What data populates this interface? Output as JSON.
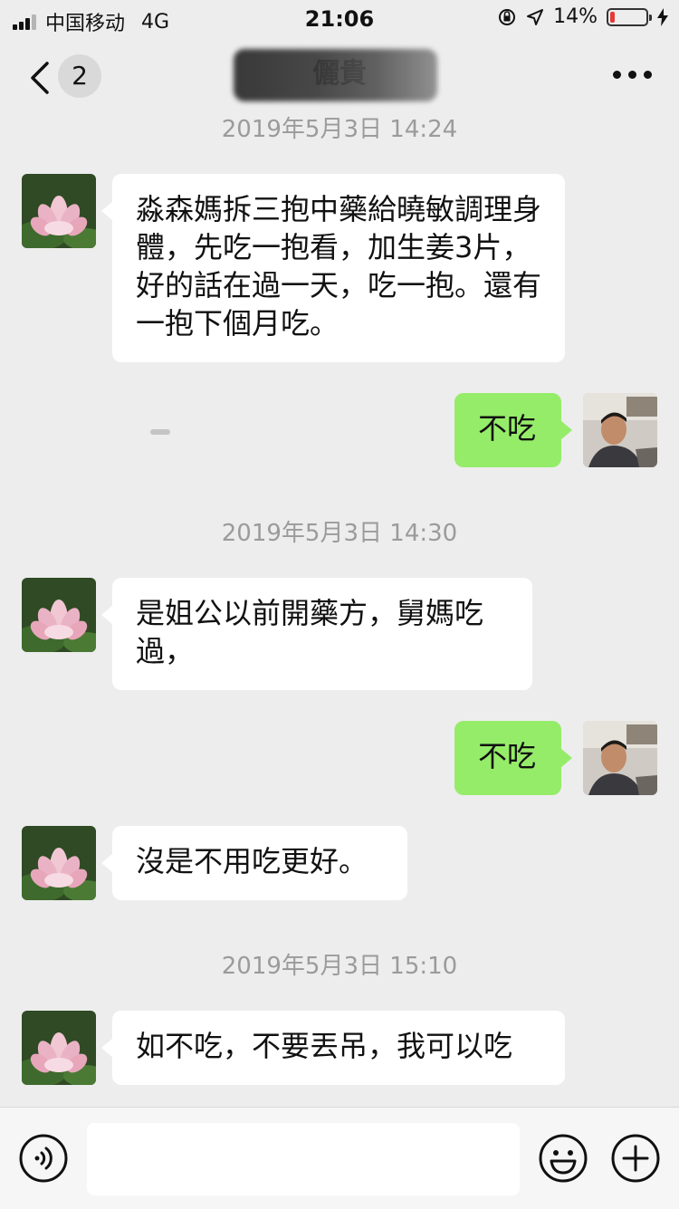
{
  "status_bar": {
    "carrier": "中国移动",
    "network": "4G",
    "time": "21:06",
    "battery_percent": "14%",
    "battery_level": 0.14,
    "battery_color": "#e53935"
  },
  "nav": {
    "unread_count": "2",
    "title": "儷貴",
    "back_icon": "chevron-left-icon",
    "more_icon": "more-dots-icon"
  },
  "messages": [
    {
      "type": "time",
      "text": "2019年5月3日 14:24"
    },
    {
      "type": "in",
      "text": "淼森媽拆三抱中藥給曉敏調理身體，先吃一抱看，加生姜3片，好的話在過一天，吃一抱。還有一抱下個月吃。"
    },
    {
      "type": "out",
      "text": "不吃"
    },
    {
      "type": "time",
      "text": "2019年5月3日 14:30"
    },
    {
      "type": "in",
      "text": "是姐公以前開藥方，舅媽吃過，"
    },
    {
      "type": "out",
      "text": "不吃"
    },
    {
      "type": "in",
      "text": "沒是不用吃更好。"
    },
    {
      "type": "time",
      "text": "2019年5月3日 15:10"
    },
    {
      "type": "in",
      "text": "如不吃，不要丟吊，我可以吃"
    }
  ],
  "input_bar": {
    "placeholder": "",
    "voice_icon": "voice-icon",
    "emoji_icon": "emoji-icon",
    "plus_icon": "plus-icon"
  },
  "colors": {
    "background": "#ededed",
    "outgoing_bubble": "#95ec69",
    "incoming_bubble": "#ffffff",
    "timestamp": "#9b9b9b"
  }
}
